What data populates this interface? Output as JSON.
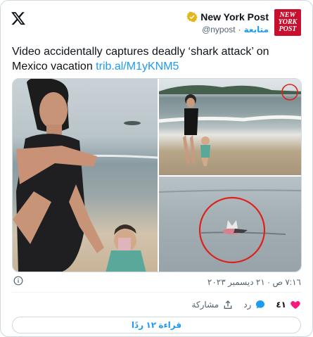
{
  "account": {
    "display_name": "New York Post",
    "handle": "@nypost",
    "separator": "·",
    "follow_label": "متابعة",
    "avatar_line1": "NEW",
    "avatar_line2": "YORK",
    "avatar_line3": "POST"
  },
  "tweet": {
    "text": "Video accidentally captures deadly ‘shark attack’ on Mexico vacation ",
    "link": "trib.al/M1yKNM5",
    "timestamp": "٧:١٦ ص · ٢١ ديسمبر ٢٠٢٣"
  },
  "actions": {
    "like_count": "٤١",
    "reply_label": "رد",
    "share_label": "مشاركة"
  },
  "read_replies_label": "قراءة ١٢ ردًا",
  "colors": {
    "accent": "#1d9bf0",
    "like": "#f91880",
    "brand": "#c8102e",
    "verified": "#e2b719"
  },
  "icons": [
    "x-logo-icon",
    "verified-badge-icon",
    "info-icon",
    "heart-icon",
    "reply-icon",
    "share-icon"
  ]
}
